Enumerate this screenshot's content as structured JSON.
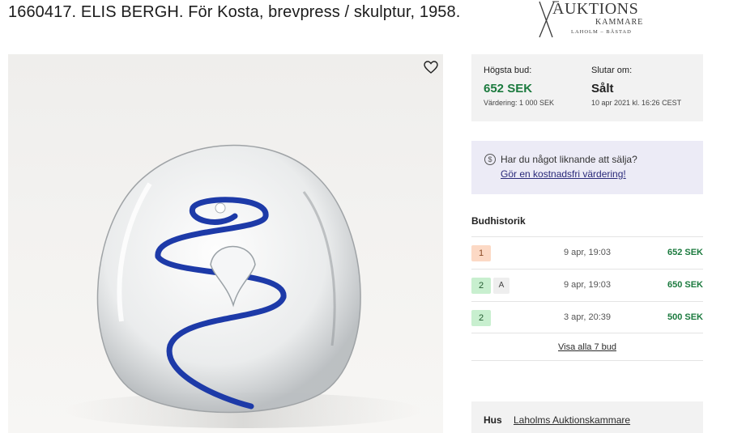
{
  "page": {
    "title": "1660417. ELIS BERGH. För Kosta, brevpress / skulptur, 1958."
  },
  "logo": {
    "name": "AUKTIONS",
    "sub": "KAMMARE",
    "place": "LAHOLM – BÅSTAD"
  },
  "bidding": {
    "highest_label": "Högsta bud:",
    "highest_value": "652 SEK",
    "valuation": "Värdering: 1 000 SEK",
    "ends_label": "Slutar om:",
    "ends_value": "Sålt",
    "ends_date": "10 apr 2021 kl. 16:26 CEST"
  },
  "sell_prompt": {
    "icon": "dollar-circle-icon",
    "question": "Har du något liknande att sälja?",
    "link": "Gör en kostnadsfri värdering!"
  },
  "history": {
    "title": "Budhistorik",
    "rows": [
      {
        "bidder": "1",
        "auto": "",
        "date": "9 apr, 19:03",
        "amount": "652 SEK",
        "color": "orange"
      },
      {
        "bidder": "2",
        "auto": "A",
        "date": "9 apr, 19:03",
        "amount": "650 SEK",
        "color": "green"
      },
      {
        "bidder": "2",
        "auto": "",
        "date": "3 apr, 20:39",
        "amount": "500 SEK",
        "color": "green"
      }
    ],
    "show_all": "Visa alla 7 bud"
  },
  "house": {
    "label": "Hus",
    "name": "Laholms Auktionskammare"
  },
  "colors": {
    "accent_green": "#1b7a3e",
    "sell_bg": "#ecebf6",
    "panel_bg": "#f2f2f2"
  }
}
